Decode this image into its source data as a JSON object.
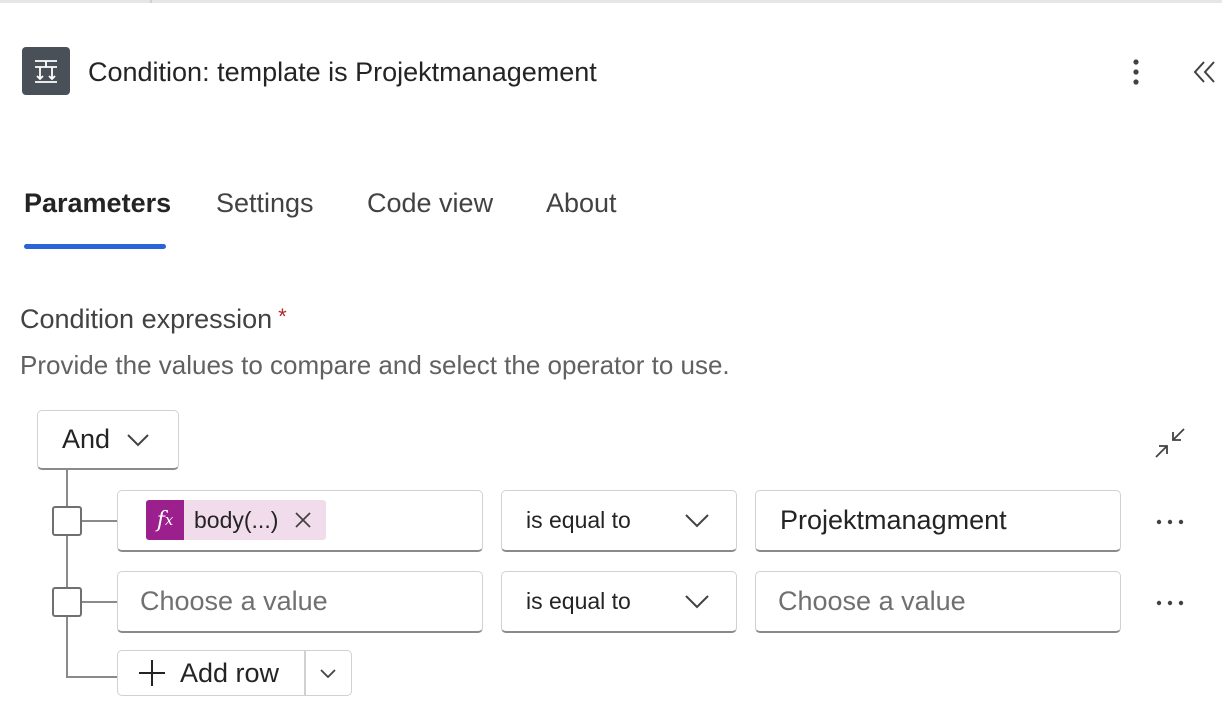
{
  "header": {
    "title": "Condition: template is Projektmanagement",
    "icon": "condition-icon"
  },
  "tabs": [
    {
      "label": "Parameters",
      "active": true
    },
    {
      "label": "Settings",
      "active": false
    },
    {
      "label": "Code view",
      "active": false
    },
    {
      "label": "About",
      "active": false
    }
  ],
  "condition": {
    "label": "Condition expression",
    "required_marker": "*",
    "description": "Provide the values to compare and select the operator to use.",
    "group_operator": "And",
    "rows": [
      {
        "left_token": {
          "fx": "f",
          "fx_sub": "x",
          "label": "body(...)"
        },
        "operator": "is equal to",
        "right_value": "Projektmanagment"
      },
      {
        "left_placeholder": "Choose a value",
        "operator": "is equal to",
        "right_placeholder": "Choose a value"
      }
    ],
    "add_row_label": "Add row"
  },
  "colors": {
    "accent": "#2b63d9",
    "fx_token_bg": "#9b1f8c",
    "token_bg": "#f1dcec",
    "required": "#b1282d"
  }
}
